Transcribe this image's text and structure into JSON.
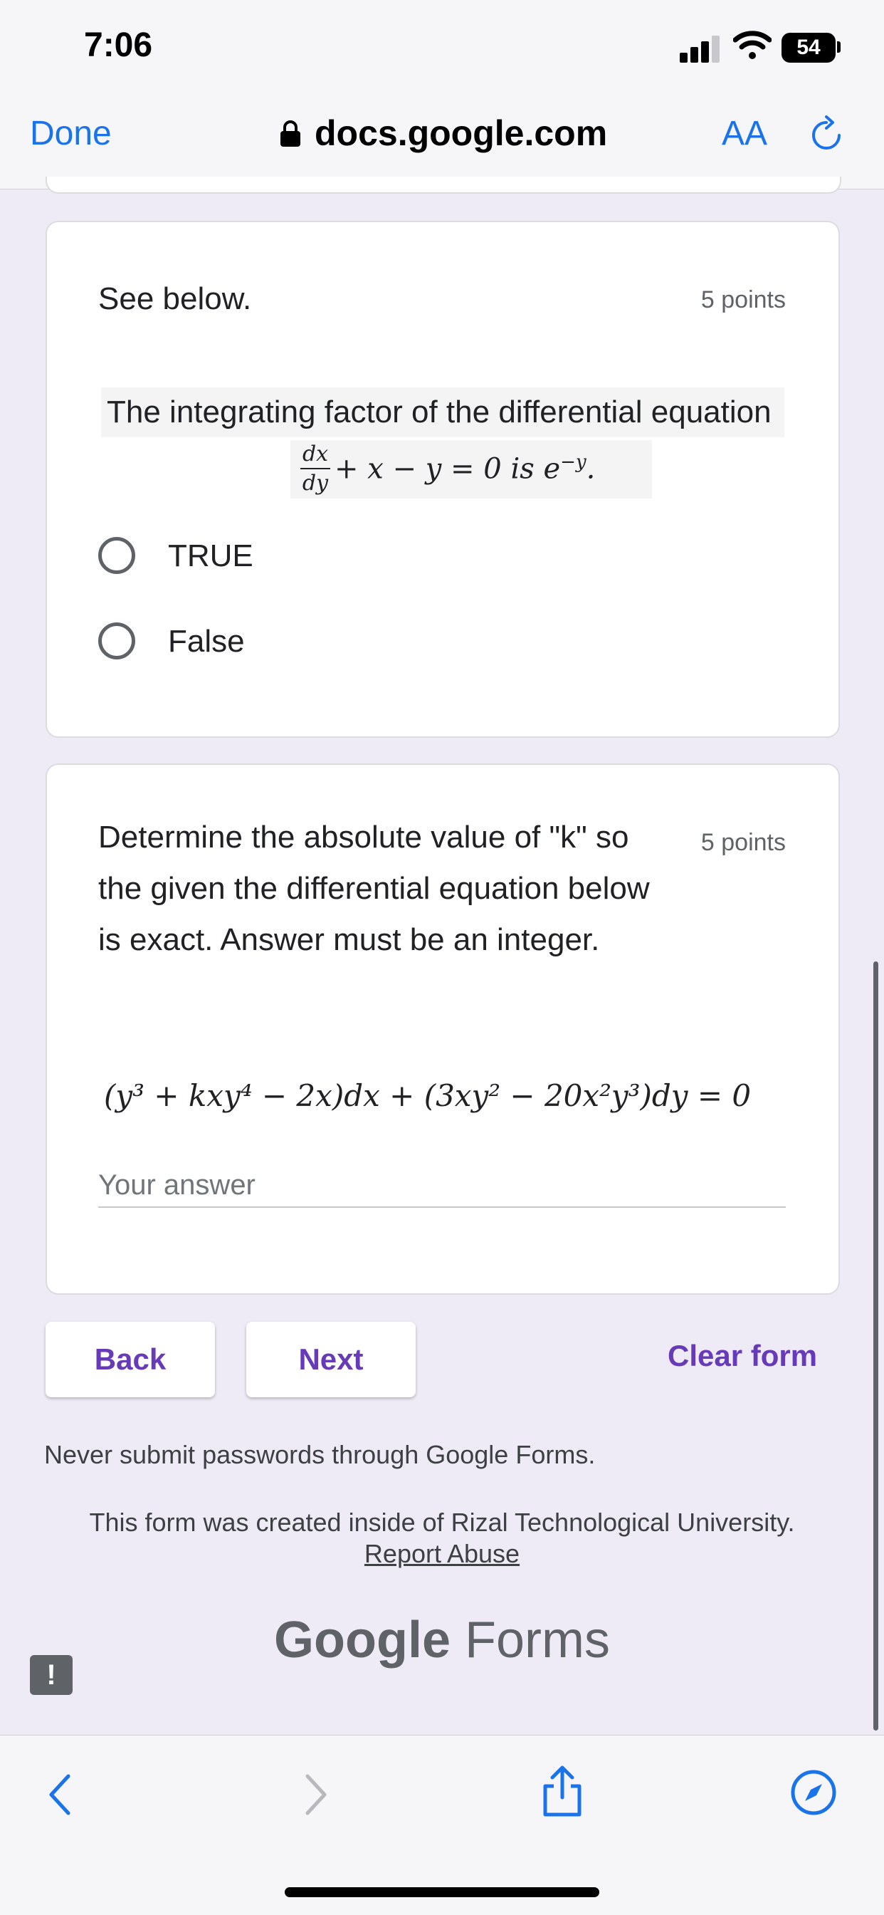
{
  "status": {
    "time": "7:06",
    "battery": "54"
  },
  "browser": {
    "done_label": "Done",
    "domain": "docs.google.com",
    "aa_label": "AA"
  },
  "q1": {
    "title": "See below.",
    "points": "5 points",
    "statement": "The integrating factor of the differential equation",
    "frac_num": "dx",
    "frac_den": "dy",
    "eq_rest": "+ x − y = 0 is e",
    "exp": "−y",
    "period": ".",
    "options": [
      "TRUE",
      "False"
    ]
  },
  "q2": {
    "text": "Determine the absolute value of \"k\" so the given the differential equation below is exact. Answer must be an integer.",
    "points": "5 points",
    "equation": "(y³ + kxy⁴ − 2x)dx + (3xy² − 20x²y³)dy = 0",
    "answer_placeholder": "Your answer"
  },
  "nav": {
    "back": "Back",
    "next": "Next",
    "clear": "Clear form"
  },
  "footer": {
    "warning": "Never submit passwords through Google Forms.",
    "created": "This form was created inside of Rizal Technological University.",
    "report": "Report Abuse",
    "brand_google": "Google",
    "brand_forms": "Forms"
  },
  "icons": {
    "report": "!",
    "lock": "lock-icon",
    "reload": "reload-icon",
    "back_nav": "chevron-left-icon",
    "forward_nav": "chevron-right-icon",
    "share": "share-icon",
    "compass": "compass-icon"
  },
  "colors": {
    "accent": "#673ab7",
    "ios_blue": "#1a73e8",
    "background": "#efebf6"
  }
}
